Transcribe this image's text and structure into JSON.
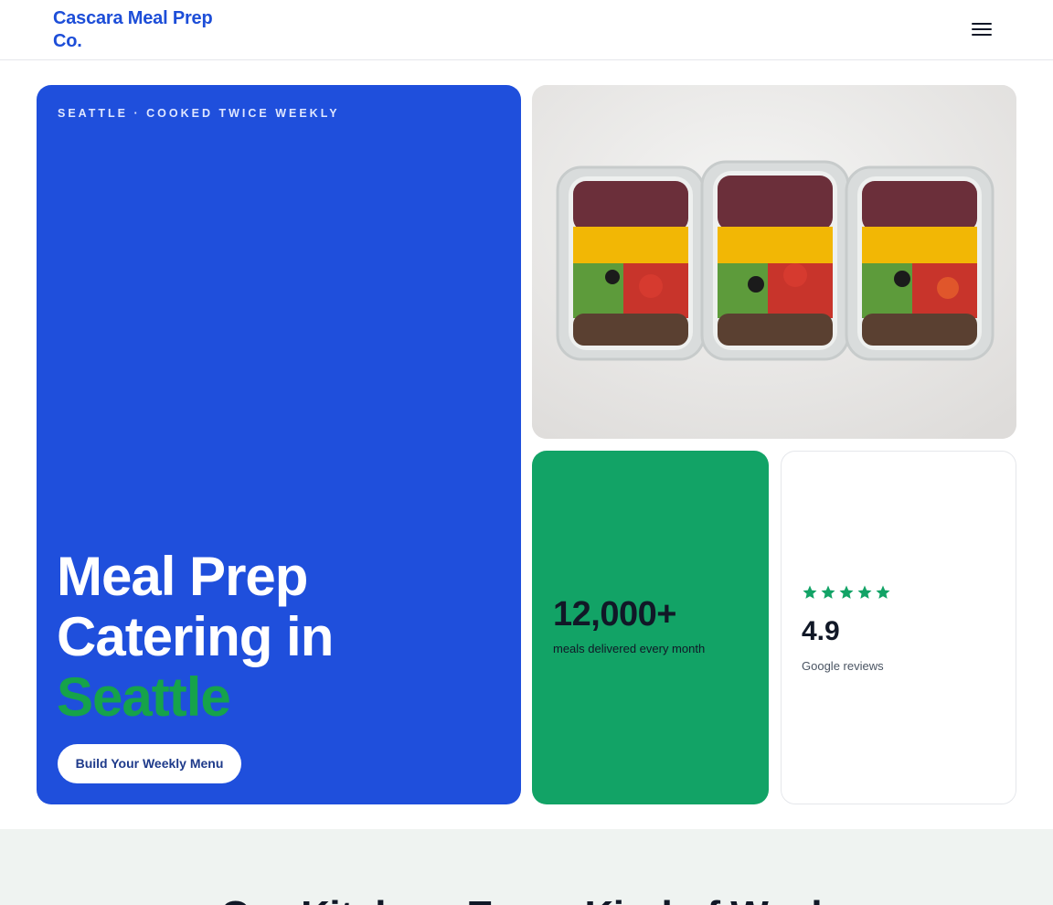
{
  "brand": {
    "name": "Cascara Meal Prep Co."
  },
  "nav": {
    "menu_icon": "hamburger-menu-icon"
  },
  "hero": {
    "eyebrow": "SEATTLE · COOKED TWICE WEEKLY",
    "headline_line1": "Meal Prep",
    "headline_line2": "Catering in",
    "headline_accent": "Seattle",
    "cta_label": "Build Your Weekly Menu"
  },
  "photo": {
    "icon": "meal-prep-containers-photo"
  },
  "stats": {
    "number": "12,000+",
    "label": "meals delivered every month"
  },
  "reviews": {
    "star_count": 5,
    "rating": "4.9",
    "label": "Google reviews"
  },
  "section": {
    "title": "Our Kitchen, Every Kind of Week"
  },
  "colors": {
    "brand_blue": "#1f4fdc",
    "accent_green": "#16a34a",
    "card_green": "#12a366",
    "star_green": "#12a366"
  }
}
